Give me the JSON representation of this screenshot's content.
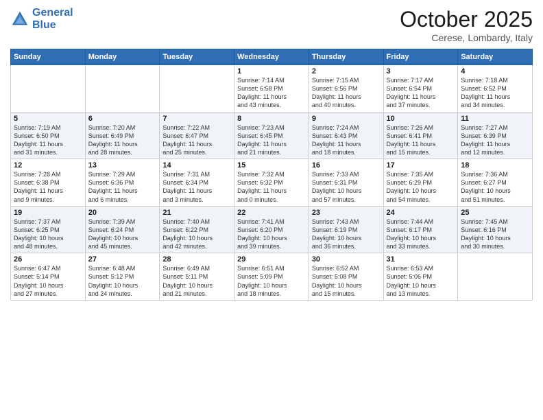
{
  "logo": {
    "line1": "General",
    "line2": "Blue"
  },
  "header": {
    "month": "October 2025",
    "location": "Cerese, Lombardy, Italy"
  },
  "weekdays": [
    "Sunday",
    "Monday",
    "Tuesday",
    "Wednesday",
    "Thursday",
    "Friday",
    "Saturday"
  ],
  "weeks": [
    [
      {
        "day": "",
        "info": ""
      },
      {
        "day": "",
        "info": ""
      },
      {
        "day": "",
        "info": ""
      },
      {
        "day": "1",
        "info": "Sunrise: 7:14 AM\nSunset: 6:58 PM\nDaylight: 11 hours\nand 43 minutes."
      },
      {
        "day": "2",
        "info": "Sunrise: 7:15 AM\nSunset: 6:56 PM\nDaylight: 11 hours\nand 40 minutes."
      },
      {
        "day": "3",
        "info": "Sunrise: 7:17 AM\nSunset: 6:54 PM\nDaylight: 11 hours\nand 37 minutes."
      },
      {
        "day": "4",
        "info": "Sunrise: 7:18 AM\nSunset: 6:52 PM\nDaylight: 11 hours\nand 34 minutes."
      }
    ],
    [
      {
        "day": "5",
        "info": "Sunrise: 7:19 AM\nSunset: 6:50 PM\nDaylight: 11 hours\nand 31 minutes."
      },
      {
        "day": "6",
        "info": "Sunrise: 7:20 AM\nSunset: 6:49 PM\nDaylight: 11 hours\nand 28 minutes."
      },
      {
        "day": "7",
        "info": "Sunrise: 7:22 AM\nSunset: 6:47 PM\nDaylight: 11 hours\nand 25 minutes."
      },
      {
        "day": "8",
        "info": "Sunrise: 7:23 AM\nSunset: 6:45 PM\nDaylight: 11 hours\nand 21 minutes."
      },
      {
        "day": "9",
        "info": "Sunrise: 7:24 AM\nSunset: 6:43 PM\nDaylight: 11 hours\nand 18 minutes."
      },
      {
        "day": "10",
        "info": "Sunrise: 7:26 AM\nSunset: 6:41 PM\nDaylight: 11 hours\nand 15 minutes."
      },
      {
        "day": "11",
        "info": "Sunrise: 7:27 AM\nSunset: 6:39 PM\nDaylight: 11 hours\nand 12 minutes."
      }
    ],
    [
      {
        "day": "12",
        "info": "Sunrise: 7:28 AM\nSunset: 6:38 PM\nDaylight: 11 hours\nand 9 minutes."
      },
      {
        "day": "13",
        "info": "Sunrise: 7:29 AM\nSunset: 6:36 PM\nDaylight: 11 hours\nand 6 minutes."
      },
      {
        "day": "14",
        "info": "Sunrise: 7:31 AM\nSunset: 6:34 PM\nDaylight: 11 hours\nand 3 minutes."
      },
      {
        "day": "15",
        "info": "Sunrise: 7:32 AM\nSunset: 6:32 PM\nDaylight: 11 hours\nand 0 minutes."
      },
      {
        "day": "16",
        "info": "Sunrise: 7:33 AM\nSunset: 6:31 PM\nDaylight: 10 hours\nand 57 minutes."
      },
      {
        "day": "17",
        "info": "Sunrise: 7:35 AM\nSunset: 6:29 PM\nDaylight: 10 hours\nand 54 minutes."
      },
      {
        "day": "18",
        "info": "Sunrise: 7:36 AM\nSunset: 6:27 PM\nDaylight: 10 hours\nand 51 minutes."
      }
    ],
    [
      {
        "day": "19",
        "info": "Sunrise: 7:37 AM\nSunset: 6:25 PM\nDaylight: 10 hours\nand 48 minutes."
      },
      {
        "day": "20",
        "info": "Sunrise: 7:39 AM\nSunset: 6:24 PM\nDaylight: 10 hours\nand 45 minutes."
      },
      {
        "day": "21",
        "info": "Sunrise: 7:40 AM\nSunset: 6:22 PM\nDaylight: 10 hours\nand 42 minutes."
      },
      {
        "day": "22",
        "info": "Sunrise: 7:41 AM\nSunset: 6:20 PM\nDaylight: 10 hours\nand 39 minutes."
      },
      {
        "day": "23",
        "info": "Sunrise: 7:43 AM\nSunset: 6:19 PM\nDaylight: 10 hours\nand 36 minutes."
      },
      {
        "day": "24",
        "info": "Sunrise: 7:44 AM\nSunset: 6:17 PM\nDaylight: 10 hours\nand 33 minutes."
      },
      {
        "day": "25",
        "info": "Sunrise: 7:45 AM\nSunset: 6:16 PM\nDaylight: 10 hours\nand 30 minutes."
      }
    ],
    [
      {
        "day": "26",
        "info": "Sunrise: 6:47 AM\nSunset: 5:14 PM\nDaylight: 10 hours\nand 27 minutes."
      },
      {
        "day": "27",
        "info": "Sunrise: 6:48 AM\nSunset: 5:12 PM\nDaylight: 10 hours\nand 24 minutes."
      },
      {
        "day": "28",
        "info": "Sunrise: 6:49 AM\nSunset: 5:11 PM\nDaylight: 10 hours\nand 21 minutes."
      },
      {
        "day": "29",
        "info": "Sunrise: 6:51 AM\nSunset: 5:09 PM\nDaylight: 10 hours\nand 18 minutes."
      },
      {
        "day": "30",
        "info": "Sunrise: 6:52 AM\nSunset: 5:08 PM\nDaylight: 10 hours\nand 15 minutes."
      },
      {
        "day": "31",
        "info": "Sunrise: 6:53 AM\nSunset: 5:06 PM\nDaylight: 10 hours\nand 13 minutes."
      },
      {
        "day": "",
        "info": ""
      }
    ]
  ]
}
